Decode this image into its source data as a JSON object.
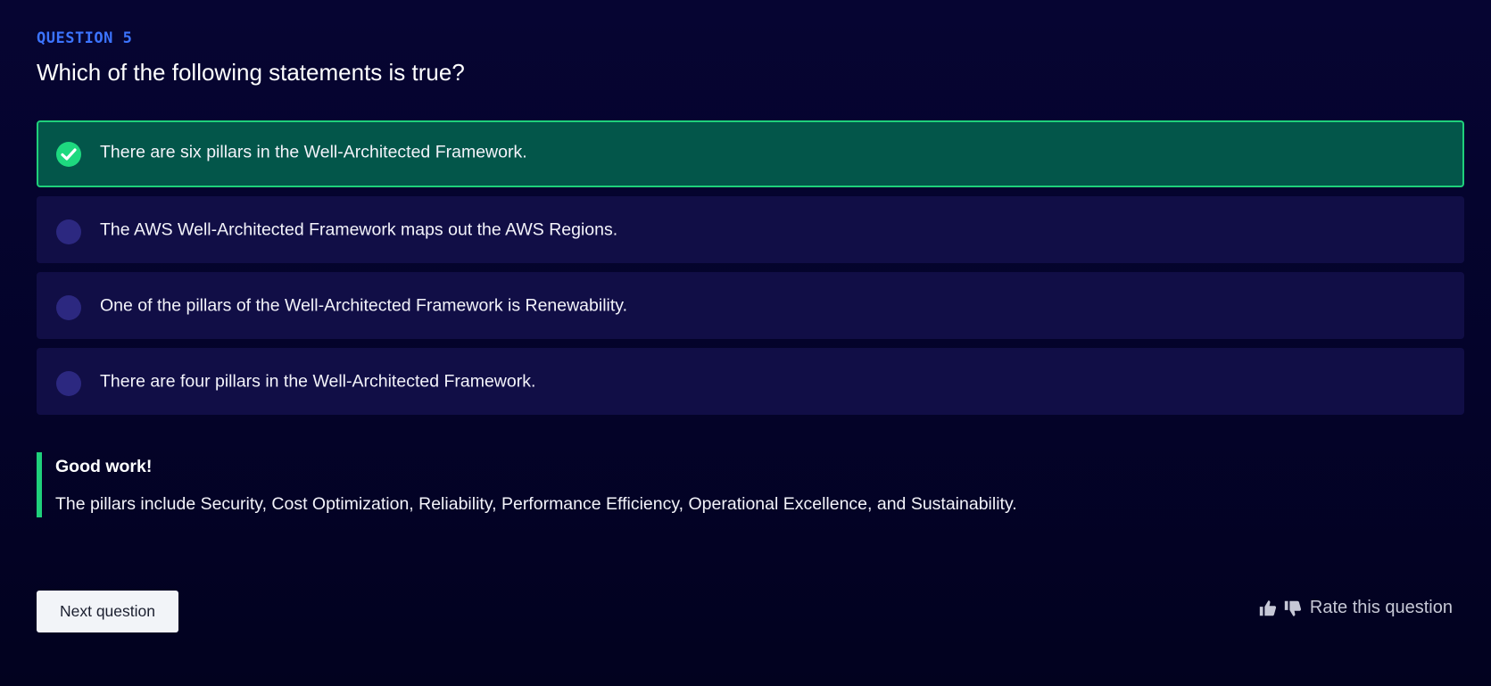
{
  "question": {
    "label": "QUESTION 5",
    "text": "Which of the following statements is true?"
  },
  "options": [
    {
      "text": "There are six pillars in the Well-Architected Framework.",
      "selected": true,
      "correct": true
    },
    {
      "text": "The AWS Well-Architected Framework maps out the AWS Regions.",
      "selected": false
    },
    {
      "text": "One of the pillars of the Well-Architected Framework is Renewability.",
      "selected": false
    },
    {
      "text": "There are four pillars in the Well-Architected Framework.",
      "selected": false
    }
  ],
  "feedback": {
    "title": "Good work!",
    "body": "The pillars include Security, Cost Optimization, Reliability, Performance Efficiency, Operational Excellence, and Sustainability."
  },
  "actions": {
    "next_label": "Next question",
    "rate_label": "Rate this question",
    "thumbs_up_icon": "thumbs-up-icon",
    "thumbs_down_icon": "thumbs-down-icon"
  },
  "colors": {
    "accent_blue": "#3c74ff",
    "correct_green": "#1fd07b",
    "selected_bg": "#03564a",
    "option_bg": "#110e46",
    "page_bg": "#04032a"
  }
}
